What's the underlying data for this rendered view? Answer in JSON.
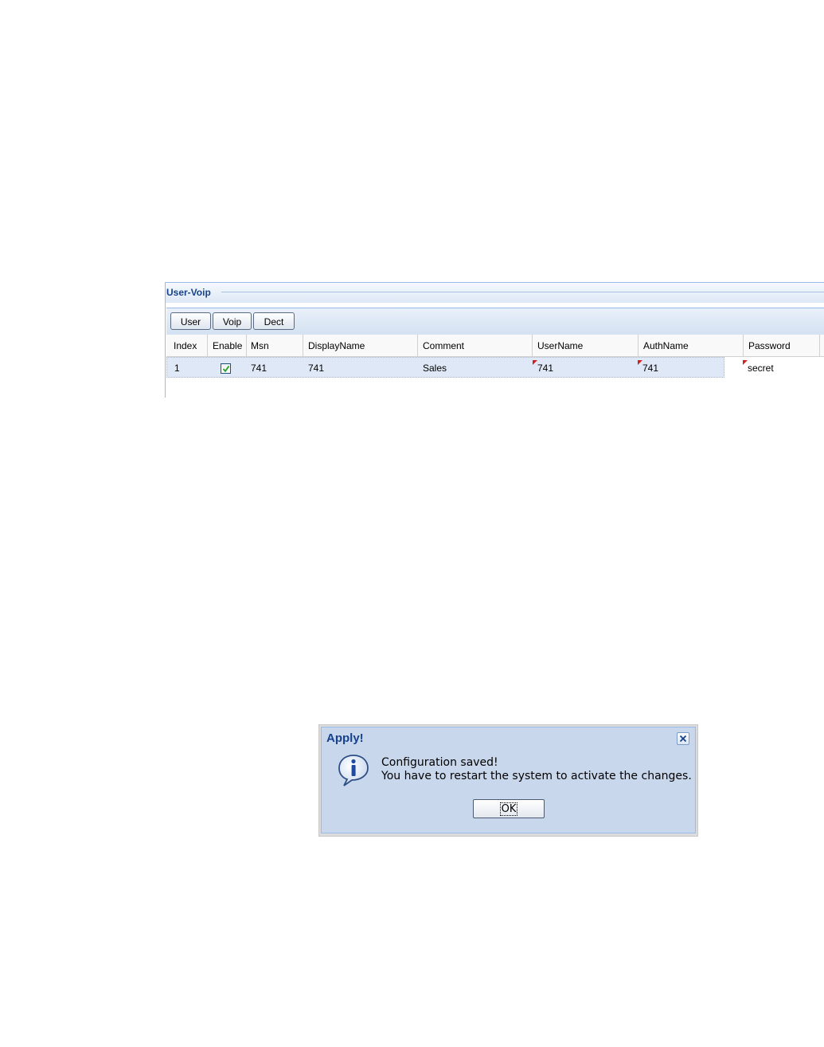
{
  "panel": {
    "title": "User-Voip",
    "toolbar": {
      "user_label": "User",
      "voip_label": "Voip",
      "dect_label": "Dect"
    },
    "columns": [
      "Index",
      "Enable",
      "Msn",
      "DisplayName",
      "Comment",
      "UserName",
      "AuthName",
      "Password"
    ],
    "rows": [
      {
        "index": "1",
        "enabled": true,
        "msn": "741",
        "display_name": "741",
        "comment": "Sales",
        "user_name": "741",
        "auth_name": "741",
        "password": "secret"
      }
    ]
  },
  "dialog": {
    "title": "Apply!",
    "line1": "Configuration saved!",
    "line2": "You have to restart the system to activate the changes.",
    "ok_label": "OK",
    "icon": "info-icon"
  },
  "colors": {
    "header_text": "#15428b",
    "row_selected": "#dfe8f6",
    "dirty_marker": "#cc2222",
    "dialog_bg": "#c9d7ec"
  }
}
